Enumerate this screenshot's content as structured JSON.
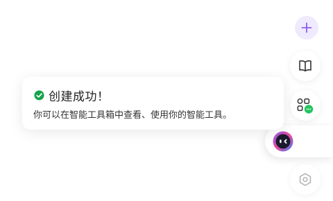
{
  "toolbar": {
    "new_icon": "plus-icon",
    "library_icon": "book-icon",
    "apps_icon": "apps-grid-icon",
    "assistant_icon": "assistant-avatar-icon",
    "settings_icon": "hexagon-settings-icon"
  },
  "toast": {
    "title": "创建成功！",
    "message": "你可以在智能工具箱中查看、使用你的智能工具。",
    "status_icon": "check-circle-icon"
  },
  "colors": {
    "accent": "#8b5cf6",
    "success": "#16a34a",
    "badge": "#22c55e",
    "icon_gray": "#333333",
    "muted_icon": "#b0b0b0"
  }
}
